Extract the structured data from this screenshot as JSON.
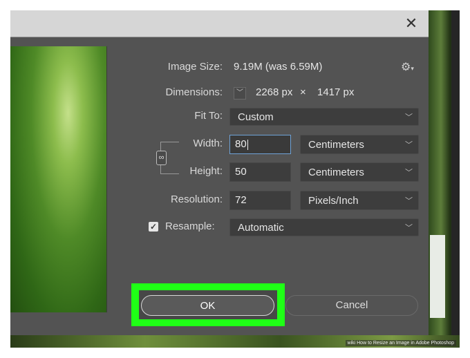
{
  "dialog": {
    "close_icon": "close-icon",
    "image_size": {
      "label": "Image Size:",
      "value": "9.19M (was 6.59M)"
    },
    "settings_icon": "gear-icon",
    "settings_glyph": "⚙",
    "settings_caret": "▾",
    "dimensions": {
      "label": "Dimensions:",
      "width": "2268 px",
      "times": "×",
      "height": "1417 px"
    },
    "fit_to": {
      "label": "Fit To:",
      "value": "Custom"
    },
    "width": {
      "label": "Width:",
      "value": "80",
      "unit": "Centimeters"
    },
    "height": {
      "label": "Height:",
      "value": "50",
      "unit": "Centimeters"
    },
    "resolution": {
      "label": "Resolution:",
      "value": "72",
      "unit": "Pixels/Inch"
    },
    "resample": {
      "label": "Resample:",
      "checked": true,
      "value": "Automatic"
    },
    "ok_label": "OK",
    "cancel_label": "Cancel"
  },
  "highlight_color": "#1fff16",
  "watermark": "wiki How to Resize an Image in Adobe Photoshop"
}
